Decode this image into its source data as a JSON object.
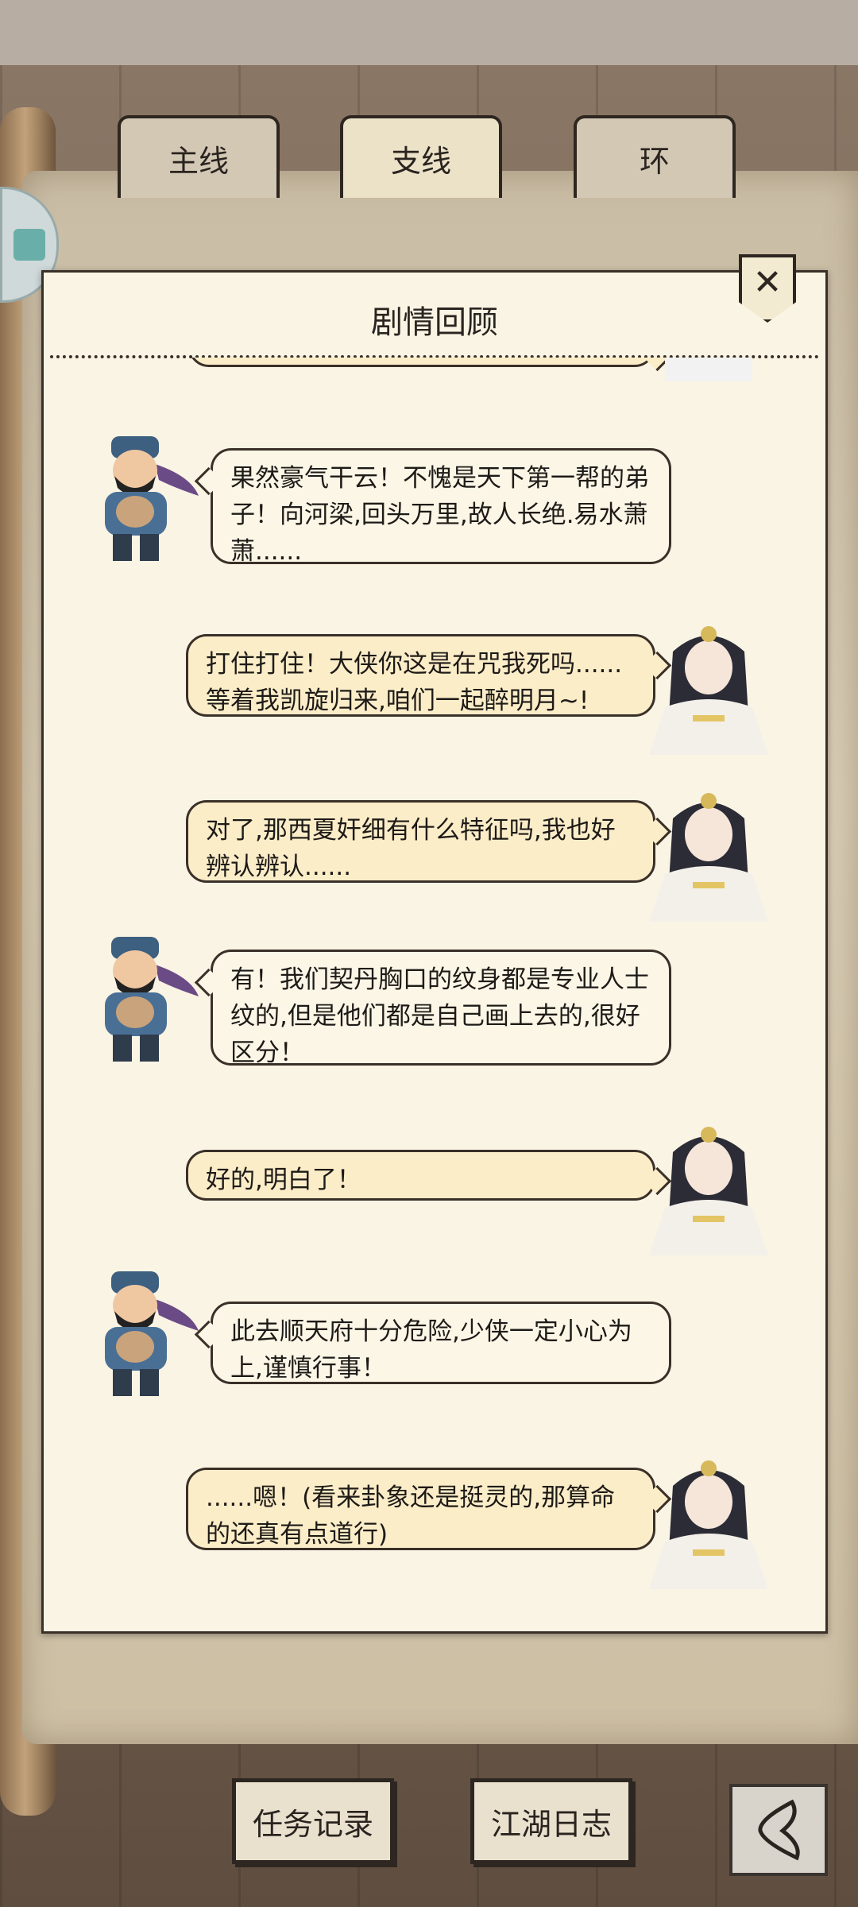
{
  "tabs": [
    {
      "label": "主线"
    },
    {
      "label": "支线"
    },
    {
      "label": "环"
    }
  ],
  "active_tab": "支线",
  "panel": {
    "title": "剧情回顾",
    "close_icon": "close-icon"
  },
  "messages": [
    {
      "speaker": "male-npc",
      "side": "left",
      "text": "果然豪气干云！不愧是天下第一帮的弟子！向河梁,回头万里,故人长绝.易水萧萧......"
    },
    {
      "speaker": "female-player",
      "side": "right",
      "text": "打住打住！大侠你这是在咒我死吗......等着我凯旋归来,咱们一起醉明月~!"
    },
    {
      "speaker": "female-player",
      "side": "right",
      "text": "对了,那西夏奸细有什么特征吗,我也好辨认辨认......"
    },
    {
      "speaker": "male-npc",
      "side": "left",
      "text": "有！我们契丹胸口的纹身都是专业人士纹的,但是他们都是自己画上去的,很好区分！"
    },
    {
      "speaker": "female-player",
      "side": "right",
      "text": "好的,明白了！"
    },
    {
      "speaker": "male-npc",
      "side": "left",
      "text": "此去顺天府十分危险,少侠一定小心为上,谨慎行事！"
    },
    {
      "speaker": "female-player",
      "side": "right",
      "text": "......嗯！(看来卦象还是挺灵的,那算命的还真有点道行)"
    }
  ],
  "bottom": {
    "task_record": "任务记录",
    "jianghu_log": "江湖日志",
    "back_icon": "back-icon"
  }
}
